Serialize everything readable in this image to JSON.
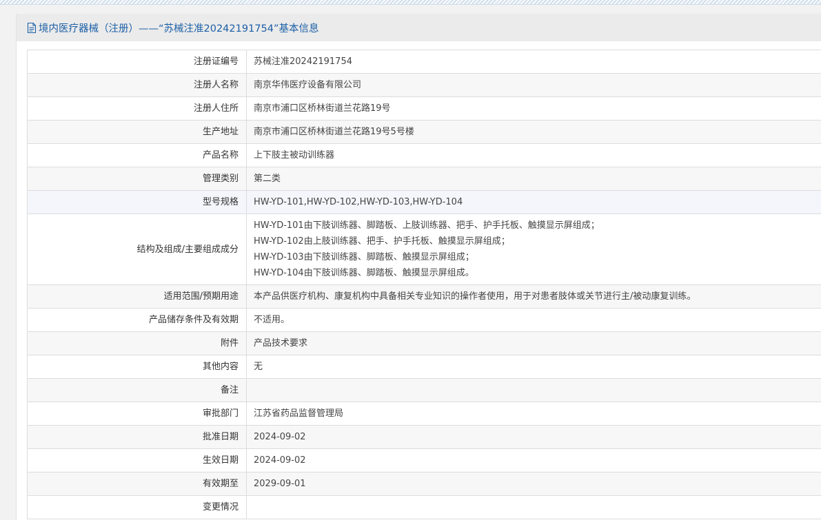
{
  "header": {
    "title": "境内医疗器械（注册）——“苏械注准20242191754”基本信息"
  },
  "rows": [
    {
      "label": "注册证编号",
      "value": "苏械注准20242191754"
    },
    {
      "label": "注册人名称",
      "value": "南京华伟医疗设备有限公司"
    },
    {
      "label": "注册人住所",
      "value": "南京市浦口区桥林街道兰花路19号"
    },
    {
      "label": "生产地址",
      "value": "南京市浦口区桥林街道兰花路19号5号楼"
    },
    {
      "label": "产品名称",
      "value": "上下肢主被动训练器"
    },
    {
      "label": "管理类别",
      "value": "第二类"
    },
    {
      "label": "型号规格",
      "value": "HW-YD-101,HW-YD-102,HW-YD-103,HW-YD-104"
    },
    {
      "label": "结构及组成/主要组成成分",
      "lines": [
        "HW-YD-101由下肢训练器、脚踏板、上肢训练器、把手、护手托板、触摸显示屏组成；",
        "HW-YD-102由上肢训练器、把手、护手托板、触摸显示屏组成；",
        "HW-YD-103由下肢训练器、脚踏板、触摸显示屏组成；",
        "HW-YD-104由下肢训练器、脚踏板、触摸显示屏组成。"
      ]
    },
    {
      "label": "适用范围/预期用途",
      "value": "本产品供医疗机构、康复机构中具备相关专业知识的操作者使用，用于对患者肢体或关节进行主/被动康复训练。"
    },
    {
      "label": "产品储存条件及有效期",
      "value": "不适用。"
    },
    {
      "label": "附件",
      "value": "产品技术要求"
    },
    {
      "label": "其他内容",
      "value": "无"
    },
    {
      "label": "备注",
      "value": ""
    },
    {
      "label": "审批部门",
      "value": "江苏省药品监督管理局"
    },
    {
      "label": "批准日期",
      "value": "2024-09-02"
    },
    {
      "label": "生效日期",
      "value": "2024-09-02"
    },
    {
      "label": "有效期至",
      "value": "2029-09-01"
    },
    {
      "label": "变更情况",
      "value": ""
    }
  ]
}
